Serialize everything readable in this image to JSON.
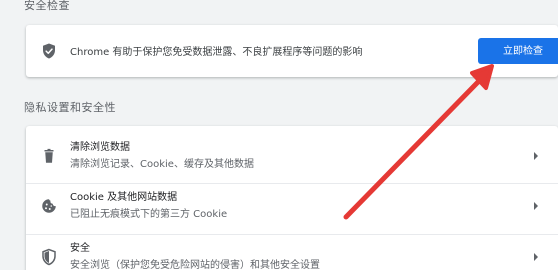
{
  "sections": {
    "safety_title": "安全检查",
    "privacy_title": "隐私设置和安全性"
  },
  "safety_check": {
    "description": "Chrome 有助于保护您免受数据泄露、不良扩展程序等问题的影响",
    "button_label": "立即检查",
    "icon": "shield-check-icon"
  },
  "privacy_items": [
    {
      "title": "清除浏览数据",
      "subtitle": "清除浏览记录、Cookie、缓存及其他数据",
      "icon": "trash-icon"
    },
    {
      "title": "Cookie 及其他网站数据",
      "subtitle": "已阻止无痕模式下的第三方 Cookie",
      "icon": "cookie-icon"
    },
    {
      "title": "安全",
      "subtitle": "安全浏览（保护您免受危险网站的侵害）和其他安全设置",
      "icon": "shield-icon"
    }
  ],
  "colors": {
    "accent": "#1a73e8",
    "arrow": "#e53935",
    "background": "#f1f3f4"
  }
}
